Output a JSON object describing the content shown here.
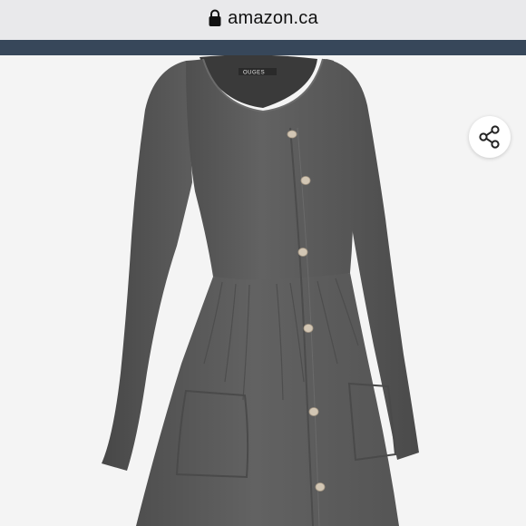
{
  "browser": {
    "url": "amazon.ca",
    "lock_icon": "lock-icon"
  },
  "header": {
    "strip_color": "#37475a"
  },
  "product": {
    "image_description_icon": "dress-image",
    "brand_tag": "OUGES",
    "dress_color": "#5e5e5e",
    "button_color": "#cfc2b0"
  },
  "actions": {
    "share_icon": "share-icon"
  }
}
